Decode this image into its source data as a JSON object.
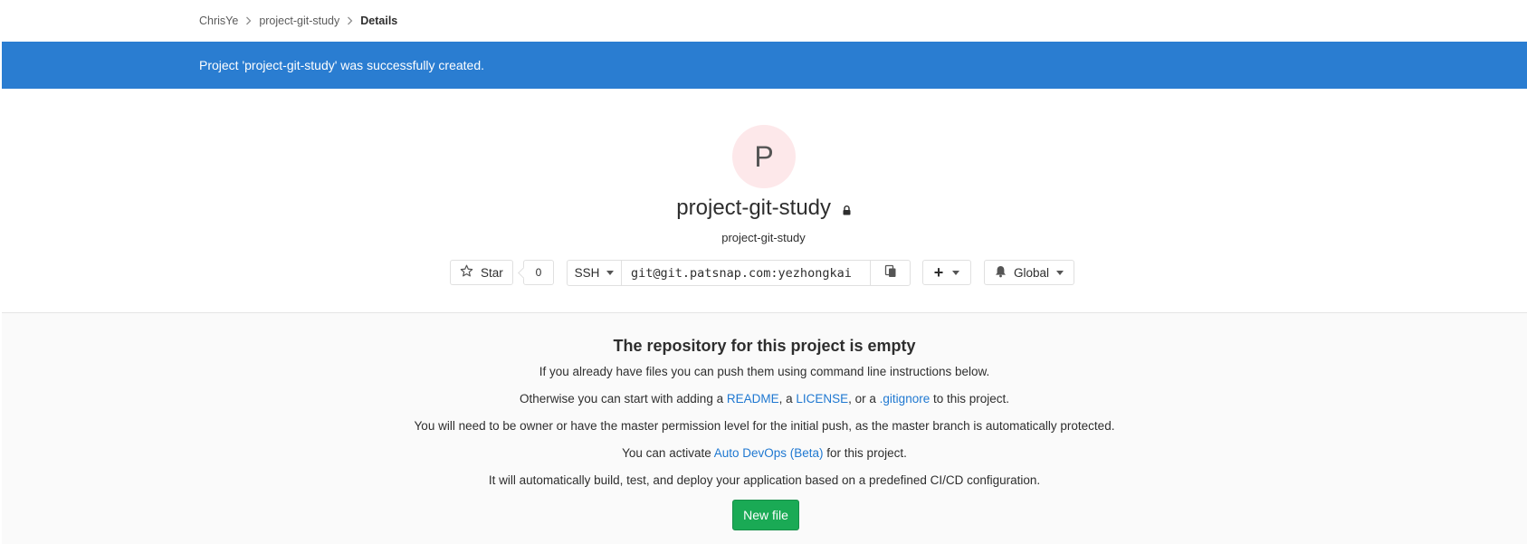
{
  "breadcrumb": {
    "items": [
      "ChrisYe",
      "project-git-study"
    ],
    "current": "Details"
  },
  "flash": {
    "message": "Project 'project-git-study' was successfully created."
  },
  "project": {
    "avatar_letter": "P",
    "name": "project-git-study",
    "subtitle": "project-git-study",
    "visibility_icon": "lock-icon"
  },
  "actions": {
    "star_label": "Star",
    "star_count": "0",
    "protocol": "SSH",
    "clone_url": "git@git.patsnap.com:yezhongkai",
    "plus_label": "+",
    "notification_label": "Global"
  },
  "empty": {
    "title": "The repository for this project is empty",
    "line1": "If you already have files you can push them using command line instructions below.",
    "line2_prefix": "Otherwise you can start with adding a ",
    "readme_link": "README",
    "sep1": ", a ",
    "license_link": "LICENSE",
    "sep2": ", or a ",
    "gitignore_link": ".gitignore",
    "line2_suffix": " to this project.",
    "line3": "You will need to be owner or have the master permission level for the initial push, as the master branch is automatically protected.",
    "line4_prefix": "You can activate ",
    "autodevops_link": "Auto DevOps (Beta)",
    "line4_suffix": " for this project.",
    "line5": "It will automatically build, test, and deploy your application based on a predefined CI/CD configuration.",
    "new_file_label": "New file"
  },
  "colors": {
    "flash_bg": "#2a7dd1",
    "link": "#1f78d1",
    "new_file_bg": "#1aaa55",
    "avatar_bg": "#fde8ea"
  }
}
